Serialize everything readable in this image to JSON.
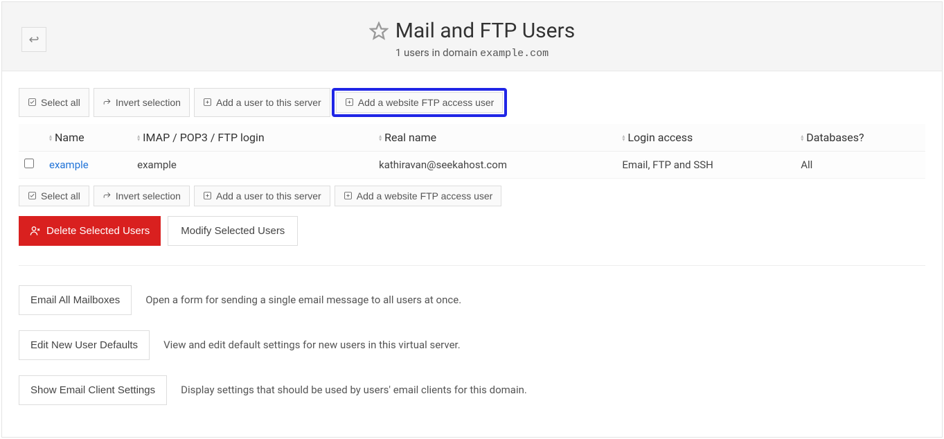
{
  "page": {
    "title": "Mail and FTP Users",
    "subtitle_prefix": "1 users in domain ",
    "subtitle_domain": "example.com"
  },
  "toolbar": {
    "select_all": "Select all",
    "invert": "Invert selection",
    "add_user": "Add a user to this server",
    "add_ftp": "Add a website FTP access user"
  },
  "table": {
    "columns": {
      "name": "Name",
      "login": "IMAP / POP3 / FTP login",
      "real": "Real name",
      "access": "Login access",
      "db": "Databases?"
    },
    "rows": [
      {
        "name": "example",
        "login": "example",
        "real": "kathiravan@seekahost.com",
        "access": "Email, FTP and SSH",
        "db": "All"
      }
    ]
  },
  "actions": {
    "delete": "Delete Selected Users",
    "modify": "Modify Selected Users"
  },
  "options": [
    {
      "btn": "Email All Mailboxes",
      "desc": "Open a form for sending a single email message to all users at once."
    },
    {
      "btn": "Edit New User Defaults",
      "desc": "View and edit default settings for new users in this virtual server."
    },
    {
      "btn": "Show Email Client Settings",
      "desc": "Display settings that should be used by users' email clients for this domain."
    }
  ]
}
